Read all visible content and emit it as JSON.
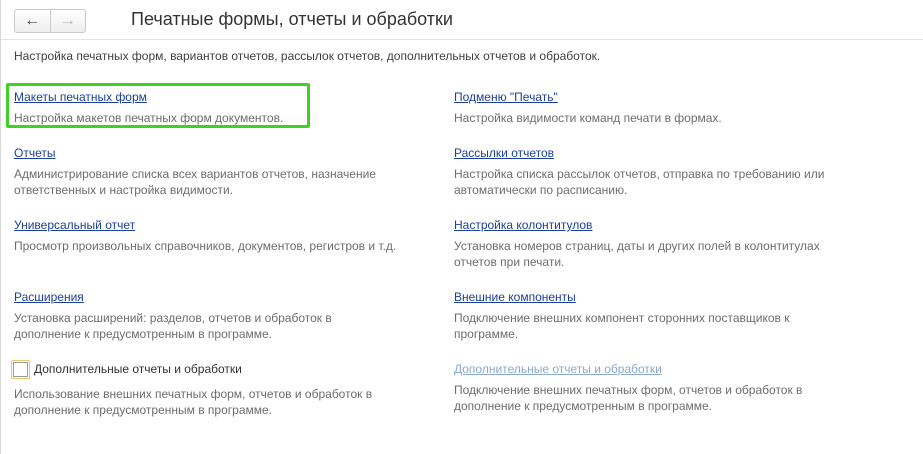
{
  "nav": {
    "back_label": "←",
    "forward_label": "→"
  },
  "header": {
    "title": "Печатные формы, отчеты и обработки"
  },
  "subtitle": "Настройка печатных форм, вариантов отчетов, рассылок отчетов, дополнительных отчетов и обработок.",
  "left": {
    "templates": {
      "link": "Макеты печатных форм",
      "desc": "Настройка макетов печатных форм документов."
    },
    "reports": {
      "link": "Отчеты",
      "desc": "Администрирование списка всех вариантов отчетов, назначение ответственных и настройка видимости."
    },
    "universal": {
      "link": "Универсальный отчет",
      "desc": "Просмотр произвольных справочников, документов, регистров и т.д."
    },
    "extensions": {
      "link": "Расширения",
      "desc": "Установка расширений: разделов, отчетов и обработок в дополнение к предусмотренным в программе."
    },
    "additional": {
      "checkbox_label": "Дополнительные отчеты и обработки",
      "checked": false,
      "desc": "Использование внешних печатных форм, отчетов и обработок в дополнение к предусмотренным в программе."
    }
  },
  "right": {
    "print_submenu": {
      "link": "Подменю \"Печать\"",
      "desc": "Настройка видимости команд печати в формах."
    },
    "mailings": {
      "link": "Рассылки отчетов",
      "desc": "Настройка списка рассылок отчетов, отправка по требованию или автоматически по расписанию."
    },
    "headers": {
      "link": "Настройка колонтитулов",
      "desc": "Установка номеров страниц, даты и других полей в колонтитулах отчетов при печати."
    },
    "components": {
      "link": "Внешние компоненты",
      "desc": "Подключение внешних компонент сторонних поставщиков к программе."
    },
    "additional": {
      "link": "Дополнительные отчеты и обработки",
      "desc": "Подключение внешних печатных форм, отчетов и обработок в дополнение к предусмотренным в программе.",
      "enabled": false
    }
  },
  "colors": {
    "accent_link": "#1a3f9c",
    "highlight": "#3fd125",
    "disabled_link": "#8aa9cf"
  }
}
